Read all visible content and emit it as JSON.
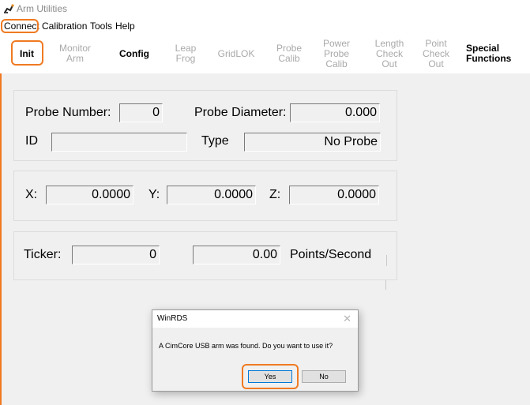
{
  "window": {
    "title": "Arm Utilities",
    "icon": "arm-app-icon"
  },
  "menu": {
    "items": [
      {
        "label": "Connect"
      },
      {
        "label": "Calibration"
      },
      {
        "label": "Tools"
      },
      {
        "label": "Help"
      }
    ]
  },
  "toolbar": {
    "buttons": [
      {
        "label": "Init",
        "active": true
      },
      {
        "label": "Monitor\nArm",
        "active": false
      },
      {
        "label": "Config",
        "active": true
      },
      {
        "label": "Leap\nFrog",
        "active": false
      },
      {
        "label": "GridLOK",
        "active": false
      },
      {
        "label": "Probe\nCalib",
        "active": false
      },
      {
        "label": "Power\nProbe\nCalib",
        "active": false
      },
      {
        "label": "Length\nCheck\nOut",
        "active": false
      },
      {
        "label": "Point\nCheck\nOut",
        "active": false
      },
      {
        "label": "Special\nFunctions",
        "active": true
      }
    ]
  },
  "probe": {
    "number_label": "Probe Number:",
    "number_value": "0",
    "diameter_label": "Probe Diameter:",
    "diameter_value": "0.000",
    "id_label": "ID",
    "id_value": "",
    "type_label": "Type",
    "type_value": "No Probe"
  },
  "coords": {
    "x_label": "X:",
    "x_value": "0.0000",
    "y_label": "Y:",
    "y_value": "0.0000",
    "z_label": "Z:",
    "z_value": "0.0000"
  },
  "ticker": {
    "label": "Ticker:",
    "value": "0",
    "rate_value": "0.00",
    "rate_unit": "Points/Second"
  },
  "dialog": {
    "title": "WinRDS",
    "close_glyph": "✕",
    "message": "A CimCore USB arm was found. Do you want to use it?",
    "yes_label": "Yes",
    "no_label": "No"
  },
  "colors": {
    "highlight": "#f07a22",
    "panel": "#f0f0f0",
    "disabled_text": "#a9a9a9"
  }
}
